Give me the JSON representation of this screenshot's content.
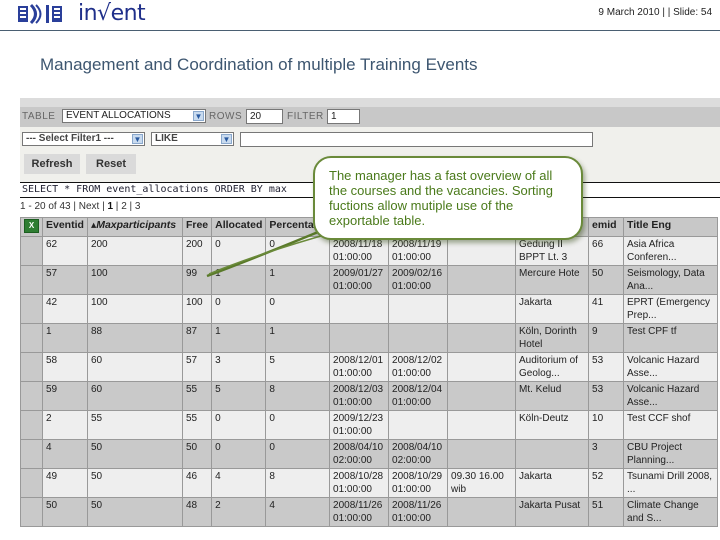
{
  "header": {
    "logo_text": "in√ent",
    "slide_info": "9 March 2010 |  | Slide: 54"
  },
  "slide_title": "Management and Coordination of multiple Training Events",
  "app": {
    "table_label": "TABLE",
    "table_select": "EVENT ALLOCATIONS",
    "rows_label": "ROWS",
    "rows_value": "20",
    "filter_label": "FILTER",
    "filter_value": "1",
    "filter1_select": "--- Select Filter1 ---",
    "operator_select": "LIKE",
    "filter_text_value": "",
    "refresh_label": "Refresh",
    "reset_label": "Reset",
    "sql_query": "SELECT * FROM event_allocations ORDER BY max",
    "pager": {
      "range_text": "1 - 20 of 43 | ",
      "next_label": "Next",
      "sep1": " | ",
      "page1": "1",
      "sep2": " | ",
      "page2": "2",
      "sep3": " | ",
      "page3": "3"
    },
    "export_icon": "excel-export-icon",
    "columns": [
      "Eventid",
      "▴Maxparticipants",
      "Free",
      "Allocated",
      "Percentage",
      "",
      "",
      "",
      "",
      "emid",
      "Title Eng"
    ],
    "rows": [
      [
        "62",
        "200",
        "200",
        "0",
        "0",
        "2008/11/18 01:00:00",
        "2008/11/19 01:00:00",
        "",
        "Gedung II BPPT Lt. 3",
        "66",
        "Asia Africa Conferen..."
      ],
      [
        "57",
        "100",
        "99",
        "1",
        "1",
        "2009/01/27 01:00:00",
        "2009/02/16 01:00:00",
        "",
        "Mercure Hote",
        "50",
        "Seismology, Data Ana..."
      ],
      [
        "42",
        "100",
        "100",
        "0",
        "0",
        "",
        "",
        "",
        "Jakarta",
        "41",
        "EPRT (Emergency Prep..."
      ],
      [
        "1",
        "88",
        "87",
        "1",
        "1",
        "",
        "",
        "",
        "Köln, Dorinth Hotel",
        "9",
        "Test CPF tf"
      ],
      [
        "58",
        "60",
        "57",
        "3",
        "5",
        "2008/12/01 01:00:00",
        "2008/12/02 01:00:00",
        "",
        "Auditorium of Geolog...",
        "53",
        "Volcanic Hazard Asse..."
      ],
      [
        "59",
        "60",
        "55",
        "5",
        "8",
        "2008/12/03 01:00:00",
        "2008/12/04 01:00:00",
        "",
        "Mt. Kelud",
        "53",
        "Volcanic Hazard Asse..."
      ],
      [
        "2",
        "55",
        "55",
        "0",
        "0",
        "2009/12/23 01:00:00",
        "",
        "",
        "Köln-Deutz",
        "10",
        "Test CCF shof"
      ],
      [
        "4",
        "50",
        "50",
        "0",
        "0",
        "2008/04/10 02:00:00",
        "2008/04/10 02:00:00",
        "",
        "",
        "3",
        "CBU Project Planning..."
      ],
      [
        "49",
        "50",
        "46",
        "4",
        "8",
        "2008/10/28 01:00:00",
        "2008/10/29 01:00:00",
        "09.30 16.00 wib",
        "Jakarta",
        "52",
        "Tsunami Drill 2008, ..."
      ],
      [
        "50",
        "50",
        "48",
        "2",
        "4",
        "2008/11/26 01:00:00",
        "2008/11/26 01:00:00",
        "",
        "Jakarta Pusat",
        "51",
        "Climate Change and S..."
      ]
    ]
  },
  "callout": {
    "text": "The manager has a fast overview of all the courses and the vacancies. Sorting fuctions allow mutiple use of the exportable table."
  }
}
